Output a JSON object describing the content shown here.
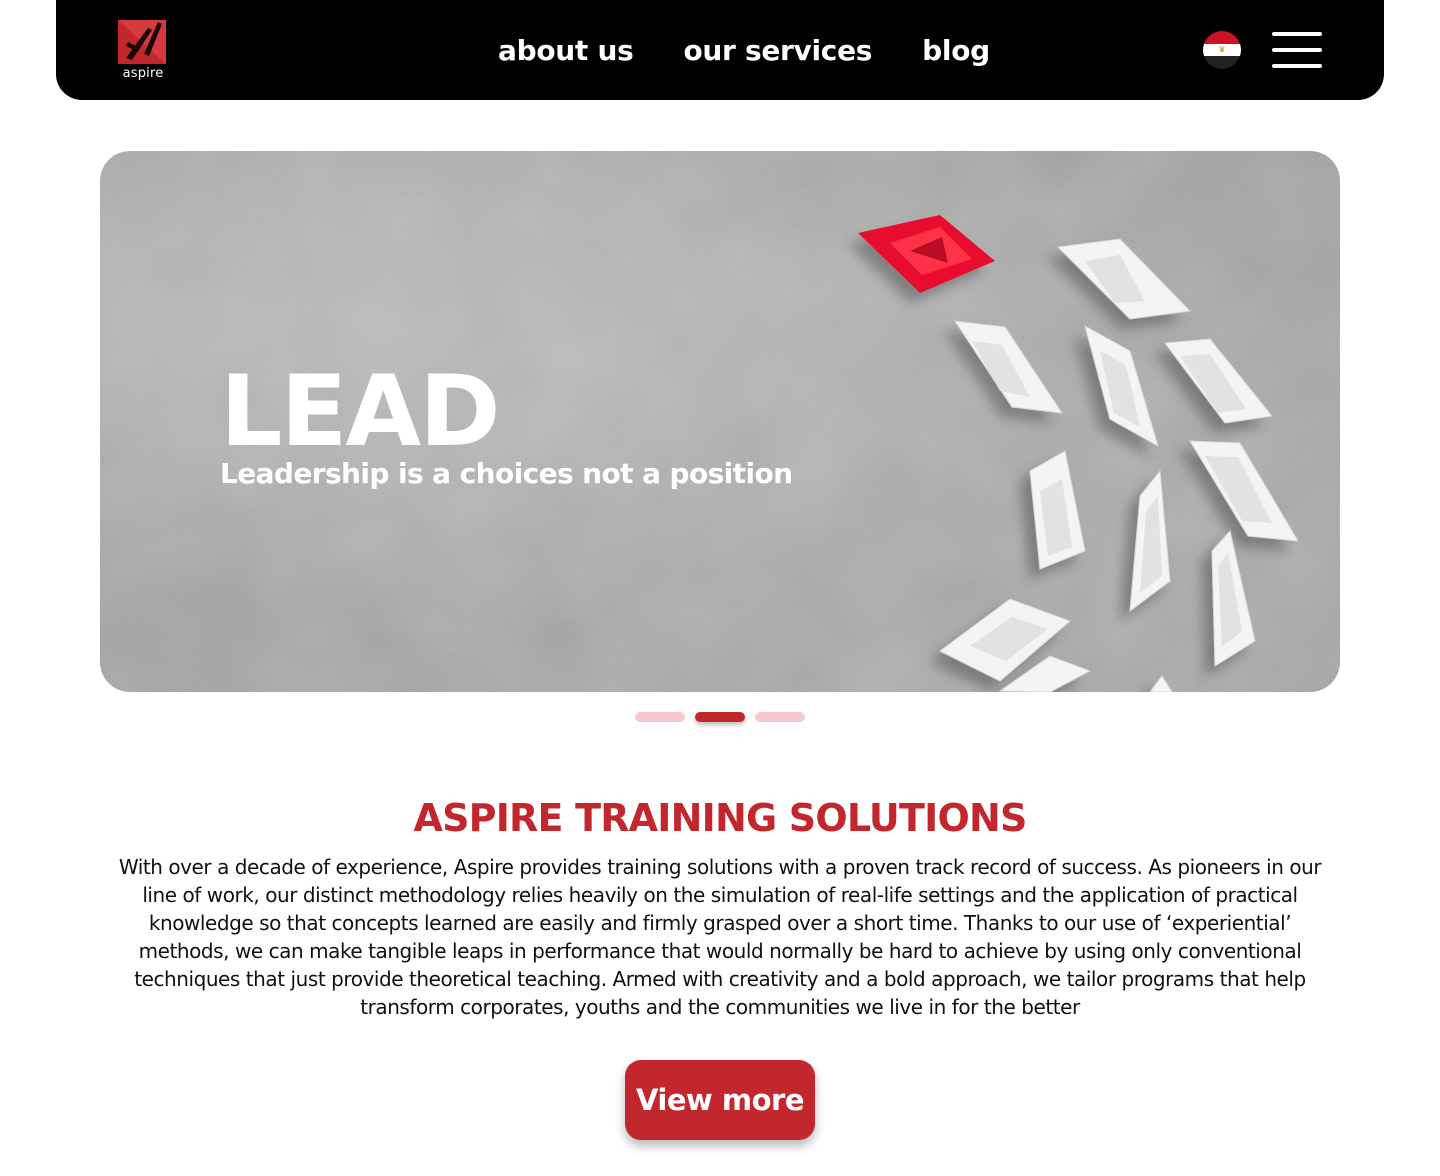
{
  "brand": {
    "name": "aspire"
  },
  "nav": {
    "items": [
      {
        "label": "about us"
      },
      {
        "label": "our services"
      },
      {
        "label": "blog"
      }
    ]
  },
  "language": {
    "flag_icon": "egypt-flag-icon"
  },
  "menu": {
    "icon": "hamburger-menu-icon"
  },
  "hero": {
    "title": "LEAD",
    "subtitle": "Leadership is a choices not a position",
    "slides_count": 3,
    "active_slide": 2
  },
  "about": {
    "title": "ASPIRE TRAINING SOLUTIONS",
    "body": "With over a decade of experience, Aspire provides training solutions with a proven track record of success. As pioneers in our line of work, our distinct methodology relies heavily on the simulation of real-life settings and the application of practical knowledge so that concepts learned are easily and firmly grasped over a short time. Thanks to our use of ‘experiential’ methods, we can make tangible leaps in performance that would normally be hard to achieve by using only conventional techniques that just provide theoretical teaching. Armed with creativity and a bold approach, we tailor programs that help transform corporates, youths and the communities we live in for the better",
    "button_label": "View more"
  },
  "colors": {
    "accent": "#c1272d",
    "dot_inactive": "#f6c8cc",
    "header_bg": "#000000"
  }
}
